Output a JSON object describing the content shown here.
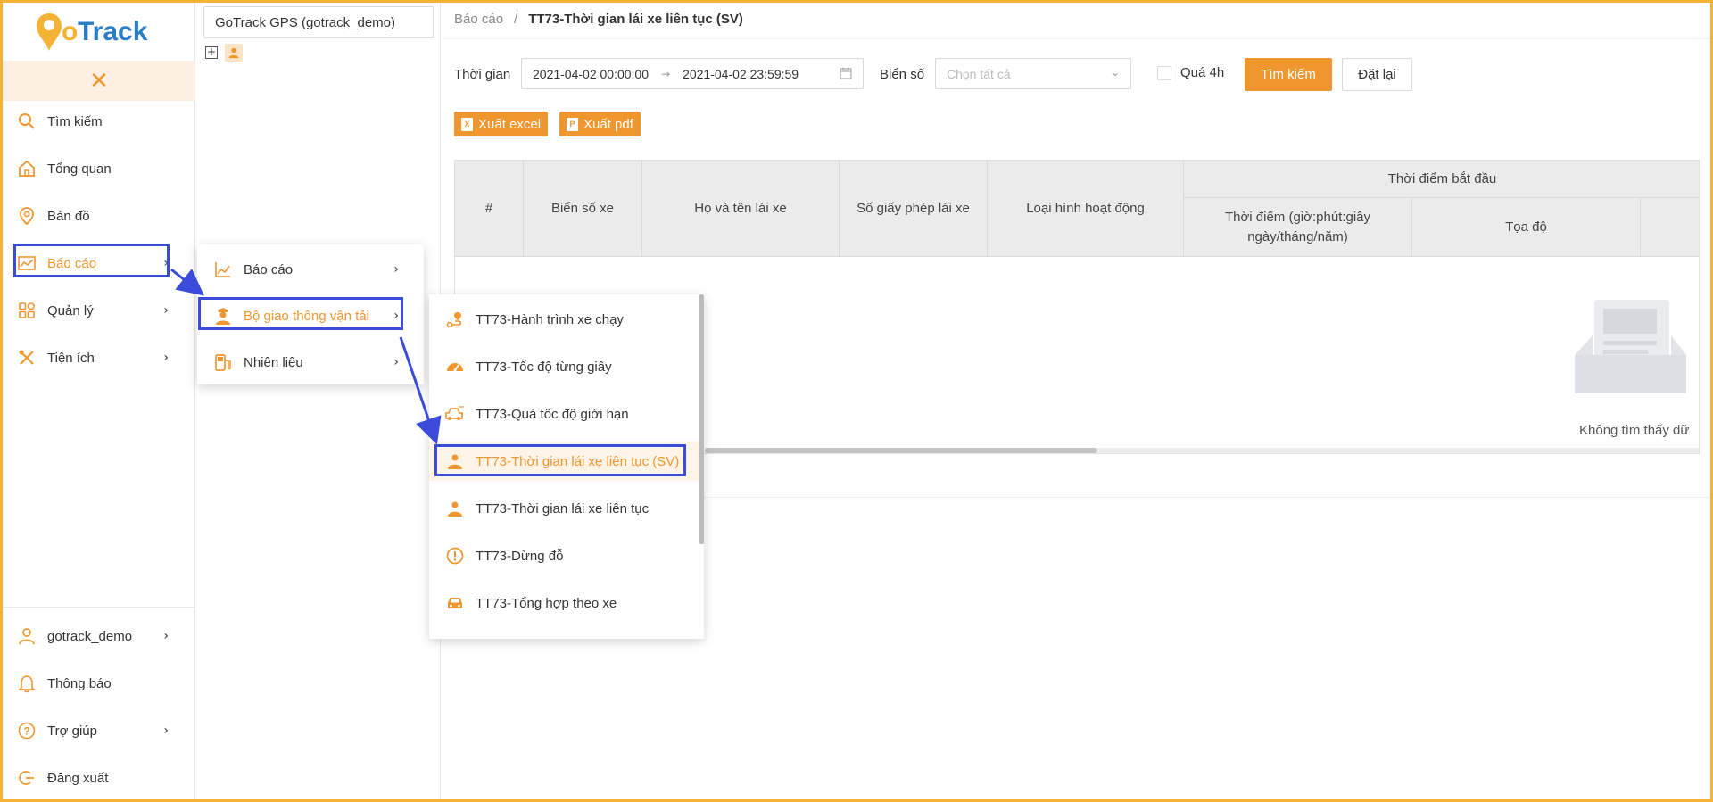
{
  "logo_text": "GoTrack",
  "brand_colors": {
    "accent": "#f0962e",
    "highlight": "#3b4cdb",
    "frame": "#f5b335"
  },
  "sidebar": {
    "close_icon": "close-icon",
    "items": [
      {
        "label": "Tìm kiếm",
        "icon": "search-icon"
      },
      {
        "label": "Tổng quan",
        "icon": "home-icon"
      },
      {
        "label": "Bản đồ",
        "icon": "map-pin-icon"
      },
      {
        "label": "Báo cáo",
        "icon": "chart-icon",
        "active": true
      },
      {
        "label": "Quản lý",
        "icon": "grid-icon"
      },
      {
        "label": "Tiện ích",
        "icon": "tools-icon"
      }
    ],
    "bottom_items": [
      {
        "label": "gotrack_demo",
        "icon": "user-icon"
      },
      {
        "label": "Thông báo",
        "icon": "bell-icon"
      },
      {
        "label": "Trợ giúp",
        "icon": "help-icon"
      },
      {
        "label": "Đăng xuất",
        "icon": "logout-icon"
      }
    ]
  },
  "tree": {
    "account_value": "GoTrack GPS (gotrack_demo)"
  },
  "submenu_report": {
    "items": [
      {
        "label": "Báo cáo",
        "icon": "line-chart-icon"
      },
      {
        "label": "Bộ giao thông vận tải",
        "icon": "officer-icon",
        "active": true
      },
      {
        "label": "Nhiên liệu",
        "icon": "fuel-icon"
      }
    ]
  },
  "submenu_transport": {
    "items": [
      {
        "label": "TT73-Hành trình xe chạy",
        "icon": "route-icon"
      },
      {
        "label": "TT73-Tốc độ từng giây",
        "icon": "speedometer-icon"
      },
      {
        "label": "TT73-Quá tốc độ giới hạn",
        "icon": "car-speed-icon"
      },
      {
        "label": "TT73-Thời gian lái xe liên tục (SV)",
        "icon": "driver-icon",
        "selected": true
      },
      {
        "label": "TT73-Thời gian lái xe liên tục",
        "icon": "driver-icon"
      },
      {
        "label": "TT73-Dừng đỗ",
        "icon": "alert-circle-icon"
      },
      {
        "label": "TT73-Tổng hợp theo xe",
        "icon": "car-icon"
      }
    ]
  },
  "main": {
    "breadcrumb": {
      "parent": "Báo cáo",
      "separator": "/",
      "current": "TT73-Thời gian lái xe liên tục (SV)"
    },
    "filters": {
      "time_label": "Thời gian",
      "date_from": "2021-04-02 00:00:00",
      "date_to": "2021-04-02 23:59:59",
      "plate_label": "Biển số",
      "plate_placeholder": "Chọn tất cả",
      "over4h_label": "Quá 4h",
      "search_button": "Tìm kiếm",
      "reset_button": "Đặt lại"
    },
    "export": {
      "excel": "Xuất excel",
      "pdf": "Xuất pdf"
    },
    "table": {
      "headers": {
        "index": "#",
        "plate": "Biển số xe",
        "driver_name": "Họ và tên lái xe",
        "license": "Số giấy phép lái xe",
        "operation_type": "Loại hình hoạt động",
        "start_group": "Thời điểm bắt đầu",
        "start_time": "Thời điểm (giờ:phút:giây ngày/tháng/năm)",
        "start_coord": "Tọa độ"
      },
      "empty_text": "Không tìm thấy dữ"
    }
  }
}
